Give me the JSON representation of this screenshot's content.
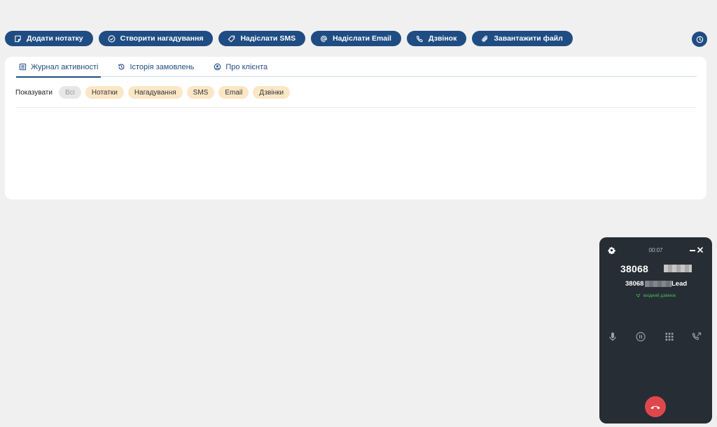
{
  "toolbar": {
    "add_note": "Додати нотатку",
    "create_reminder": "Створити нагадування",
    "send_sms": "Надіслати SMS",
    "send_email": "Надіслати Email",
    "call": "Дзвінок",
    "upload_file": "Завантажити файл"
  },
  "tabs": {
    "activity_log": "Журнал активності",
    "order_history": "Історія замовлень",
    "about_client": "Про клієнта"
  },
  "filters": {
    "label": "Показувати",
    "chips": [
      "Всі",
      "Нотатки",
      "Нагадування",
      "SMS",
      "Email",
      "Дзвінки"
    ]
  },
  "phone": {
    "timer": "00:07",
    "number_prefix": "38068",
    "sub_prefix": "38068",
    "sub_suffix": "Lead",
    "status": "вхідний дзвінок"
  },
  "colors": {
    "primary": "#1f4d83",
    "chip_bg": "#fbe6c6",
    "phone_bg": "#262d35",
    "hangup": "#e0474c",
    "status_green": "#4cc05a"
  }
}
